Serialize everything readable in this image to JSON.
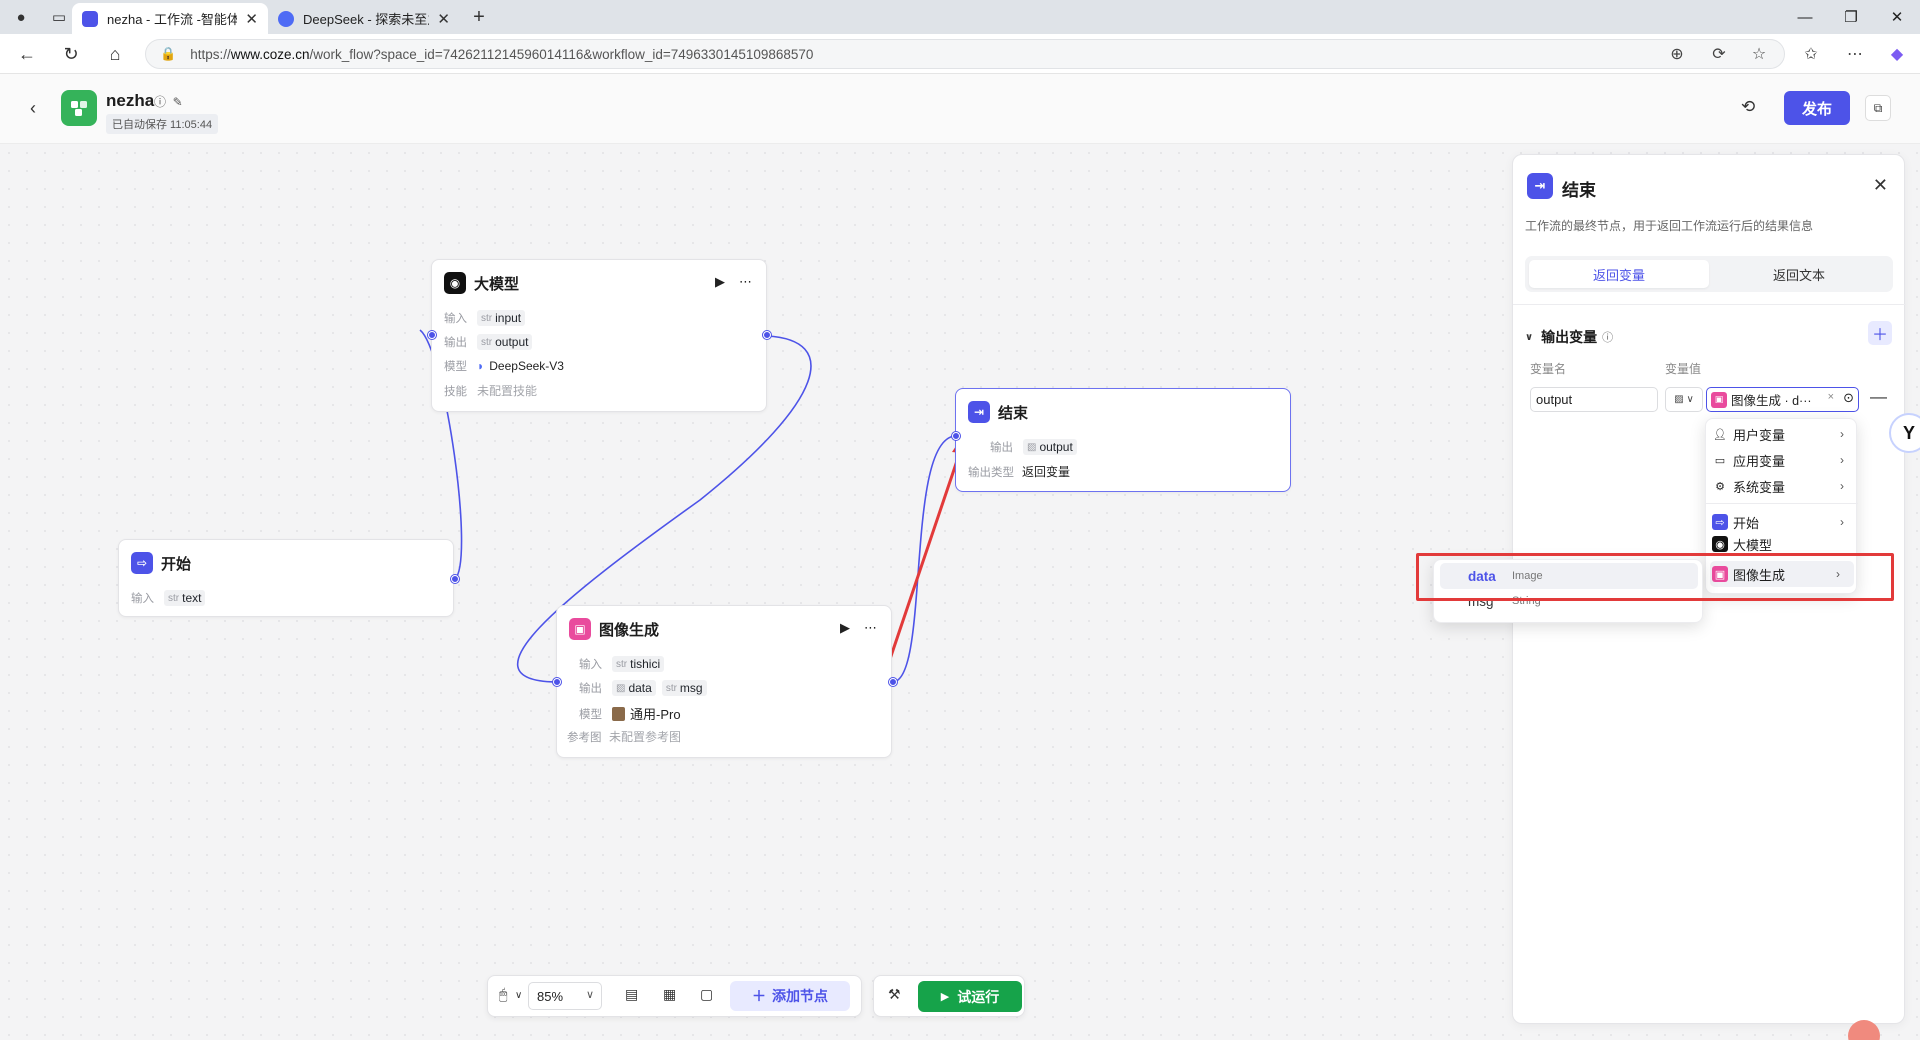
{
  "browser": {
    "tabs": [
      {
        "title": "nezha - 工作流 -智能体平台",
        "active": true
      },
      {
        "title": "DeepSeek - 探索未至之境",
        "active": false
      }
    ],
    "url_prefix": "https://",
    "url_host": "www.coze.cn",
    "url_path": "/work_flow?space_id=7426211214596014116&workflow_id=7496330145109868570"
  },
  "header": {
    "app_name": "nezha",
    "autosave": "已自动保存 11:05:44",
    "publish_label": "发布"
  },
  "nodes": {
    "llm": {
      "title": "大模型",
      "input_label": "输入",
      "input_type": "str",
      "input_var": "input",
      "output_label": "输出",
      "output_type": "str",
      "output_var": "output",
      "model_label": "模型",
      "model_value": "DeepSeek-V3",
      "skill_label": "技能",
      "skill_value": "未配置技能"
    },
    "start": {
      "title": "开始",
      "input_label": "输入",
      "input_type": "str",
      "input_var": "text"
    },
    "image": {
      "title": "图像生成",
      "input_label": "输入",
      "input_type": "str",
      "input_var": "tishici",
      "output_label": "输出",
      "output_var1": "data",
      "output_type2": "str",
      "output_var2": "msg",
      "model_label": "模型",
      "model_value": "通用-Pro",
      "ref_label": "参考图",
      "ref_value": "未配置参考图"
    },
    "end": {
      "title": "结束",
      "output_label": "输出",
      "output_var": "output",
      "type_label": "输出类型",
      "type_value": "返回变量"
    }
  },
  "toolbar": {
    "zoom": "85%",
    "add_node": "添加节点",
    "run": "试运行"
  },
  "panel": {
    "title": "结束",
    "description": "工作流的最终节点，用于返回工作流运行后的结果信息",
    "tab_return_var": "返回变量",
    "tab_return_text": "返回文本",
    "section_title": "输出变量",
    "col_name": "变量名",
    "col_value": "变量值",
    "var_name": "output",
    "var_value": "图像生成 · d···"
  },
  "dropdown": {
    "items": [
      {
        "label": "用户变量",
        "icon": "user-icon"
      },
      {
        "label": "应用变量",
        "icon": "folder-icon"
      },
      {
        "label": "系统变量",
        "icon": "gear-icon"
      },
      {
        "label": "开始",
        "icon": "start-node-icon"
      },
      {
        "label": "大模型",
        "icon": "llm-node-icon"
      },
      {
        "label": "图像生成",
        "icon": "image-node-icon"
      }
    ],
    "sub_items": [
      {
        "name": "data",
        "type": "Image"
      },
      {
        "name": "msg",
        "type": "String"
      }
    ]
  },
  "colors": {
    "accent": "#4d53e8",
    "run_green": "#16a34a",
    "image_node": "#e94b9d",
    "highlight_red": "#e23a3a"
  }
}
